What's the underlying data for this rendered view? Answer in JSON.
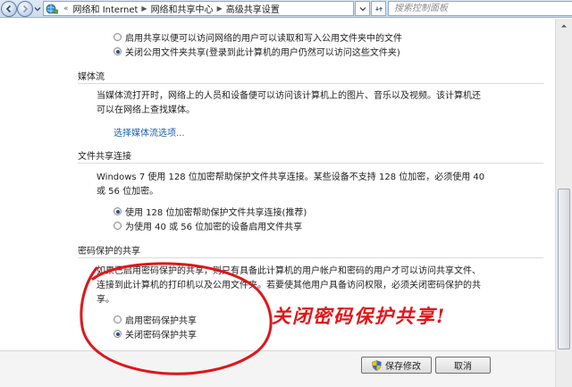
{
  "address_bar": {
    "breadcrumb_prefix": "«",
    "crumbs": [
      "网络和 Internet",
      "网络和共享中心",
      "高级共享设置"
    ],
    "search_placeholder": "搜索控制面板"
  },
  "public_folder": {
    "option_on": "启用共享以便可以访问网络的用户可以读取和写入公用文件夹中的文件",
    "option_off": "关闭公用文件夹共享(登录到此计算机的用户仍然可以访问这些文件夹)",
    "selected": "off"
  },
  "media": {
    "title": "媒体流",
    "description_line1": "当媒体流打开时，网络上的人员和设备便可以访问该计算机上的图片、音乐以及视频。该计算机还",
    "description_line2": "可以在网络上查找媒体。",
    "link": "选择媒体流选项..."
  },
  "file_sharing": {
    "title": "文件共享连接",
    "description_line1": "Windows 7 使用 128 位加密帮助保护文件共享连接。某些设备不支持 128 位加密，必须使用 40",
    "description_line2": "或 56 位加密。",
    "option_128": "使用 128 位加密帮助保护文件共享连接(推荐)",
    "option_40_56": "为使用 40 或 56 位加密的设备启用文件共享",
    "selected": "128"
  },
  "password": {
    "title": "密码保护的共享",
    "description_line1": "如果已启用密码保护的共享，则只有具备此计算机的用户帐户和密码的用户才可以访问共享文件、",
    "description_line2": "连接到此计算机的打印机以及公用文件夹。若要使其他用户具备访问权限，必须关闭密码保护的共",
    "description_line3": "享。",
    "option_on": "启用密码保护共享",
    "option_off": "关闭密码保护共享",
    "selected": "off"
  },
  "footer": {
    "save_label": "保存修改",
    "cancel_label": "取消"
  },
  "annotation": {
    "text": "关闭密码保护共享!",
    "color": "#e0161a"
  }
}
